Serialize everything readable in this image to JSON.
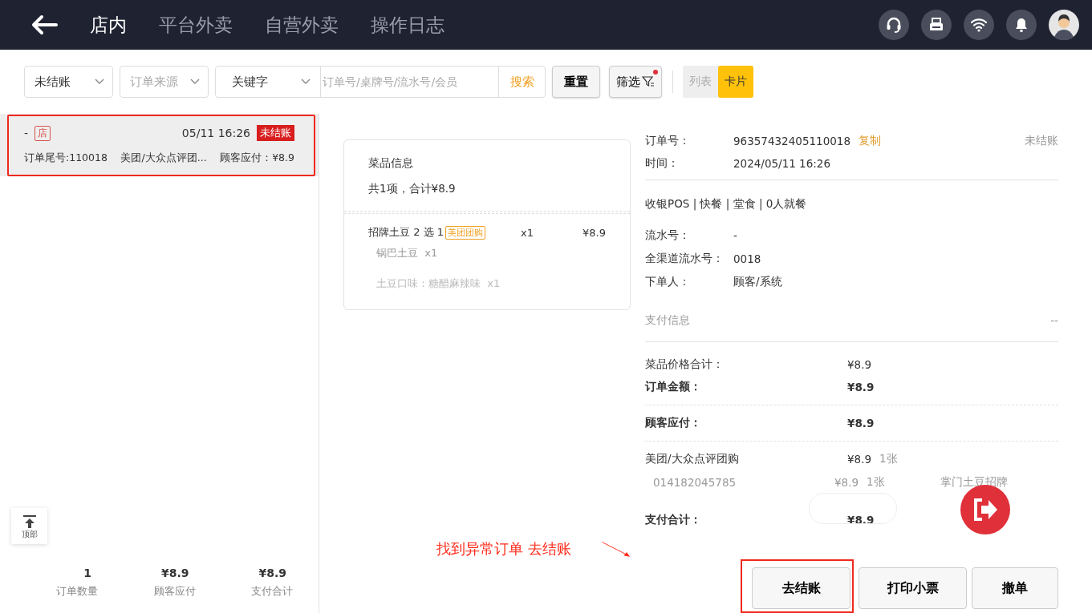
{
  "header": {
    "tabs": [
      {
        "label": "店内",
        "selected": true
      },
      {
        "label": "平台外卖",
        "selected": false
      },
      {
        "label": "自营外卖",
        "selected": false
      },
      {
        "label": "操作日志",
        "selected": false
      }
    ]
  },
  "filters": {
    "status": "未结账",
    "source": {
      "placeholder": "订单来源"
    },
    "keyword_type": "关键字",
    "search": {
      "placeholder": "订单号/桌牌号/流水号/会员"
    },
    "search_button": "搜索",
    "reset_button": "重置",
    "filter_button": {
      "label": "筛选",
      "badge": true
    },
    "view_toggle": [
      {
        "label": "列表",
        "selected": false
      },
      {
        "label": "卡片",
        "selected": true
      }
    ]
  },
  "orders": [
    {
      "table": "-",
      "tag": "店",
      "time": "05/11 16:26",
      "status": "未结账",
      "tail": "订单尾号:110018",
      "channel": "美团/大众点评团...",
      "due": "顾客应付：¥8.9",
      "selected": true,
      "highlighted": true
    }
  ],
  "back_to_top": "顶部",
  "summary": [
    {
      "value": "1",
      "label": "订单数量"
    },
    {
      "value": "¥8.9",
      "label": "顾客应付"
    },
    {
      "value": "¥8.9",
      "label": "支付合计"
    }
  ],
  "items_card": {
    "title": "菜品信息",
    "subtotal": "共1项，合计¥8.9",
    "items": [
      {
        "name": "招牌土豆 2 选 1",
        "tag": "美团团购",
        "qty": "x1",
        "price": "¥8.9",
        "options": [
          "锅巴土豆  x1",
          "土豆口味：糖醋麻辣味  x1"
        ]
      }
    ]
  },
  "details": {
    "order_no_label": "订单号：",
    "order_no": "96357432405110018",
    "copy": "复制",
    "status": "未结账",
    "time_label": "时间：",
    "time": "2024/05/11 16:26",
    "meta": "收银POS | 快餐 | 堂食 | 0人就餐",
    "fields": [
      {
        "label": "流水号：",
        "value": "-"
      },
      {
        "label": "全渠道流水号：",
        "value": "0018"
      },
      {
        "label": "下单人：",
        "value": "顾客/系统"
      }
    ],
    "payment_title": "支付信息",
    "payment_extra": "--",
    "amount_groups": [
      [
        {
          "label": "菜品价格合计：",
          "value": "¥8.9",
          "bold": false
        },
        {
          "label": "订单金额：",
          "value": "¥8.9",
          "bold": true
        }
      ],
      [
        {
          "label": "顾客应付：",
          "value": "¥8.9",
          "bold": true
        }
      ]
    ],
    "payments": [
      {
        "method": "美团/大众点评团购",
        "amount": "¥8.9",
        "count": "1张",
        "vouchers": [
          {
            "code": "014182045785",
            "amount": "¥8.9",
            "count": "1张",
            "name": "掌门土豆招牌"
          }
        ]
      }
    ],
    "payment_total": {
      "label": "支付合计：",
      "value": "¥8.9"
    }
  },
  "actions": [
    {
      "label": "去结账",
      "highlighted": true
    },
    {
      "label": "打印小票",
      "highlighted": false
    },
    {
      "label": "撤单",
      "highlighted": false
    }
  ],
  "annotation": {
    "text": "找到异常订单 去结账"
  }
}
